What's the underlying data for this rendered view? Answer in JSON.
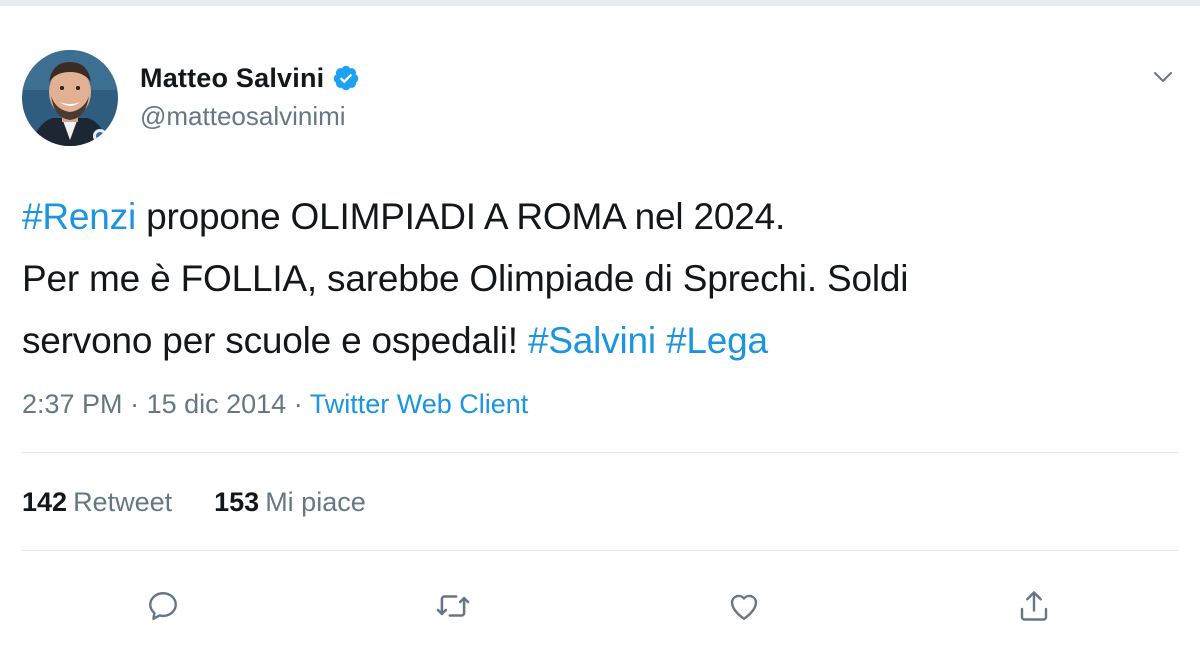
{
  "author": {
    "display_name": "Matteo Salvini",
    "handle": "@matteosalvinimi",
    "verified": true
  },
  "tweet": {
    "lines": [
      [
        {
          "text": "#Renzi",
          "type": "hashtag"
        },
        {
          "text": " propone OLIMPIADI A ROMA nel 2024.",
          "type": "text"
        }
      ],
      [
        {
          "text": "Per me è FOLLIA, sarebbe Olimpiade di Sprechi. Soldi",
          "type": "text"
        }
      ],
      [
        {
          "text": "servono per scuole e ospedali! ",
          "type": "text"
        },
        {
          "text": "#Salvini",
          "type": "hashtag"
        },
        {
          "text": " ",
          "type": "text"
        },
        {
          "text": "#Lega",
          "type": "hashtag"
        }
      ]
    ]
  },
  "meta": {
    "time": "2:37 PM",
    "separator": " · ",
    "date": "15 dic 2014",
    "source": "Twitter Web Client"
  },
  "stats": {
    "retweets_count": "142",
    "retweets_label": "Retweet",
    "likes_count": "153",
    "likes_label": "Mi piace"
  },
  "actions": [
    {
      "name": "reply",
      "icon": "reply-icon"
    },
    {
      "name": "retweet",
      "icon": "retweet-icon"
    },
    {
      "name": "like",
      "icon": "heart-icon"
    },
    {
      "name": "share",
      "icon": "share-icon"
    }
  ],
  "colors": {
    "link": "#1b95e0",
    "text": "#14171a",
    "secondary": "#657786",
    "divider": "#e1e8ed",
    "verified": "#1da1f2"
  }
}
